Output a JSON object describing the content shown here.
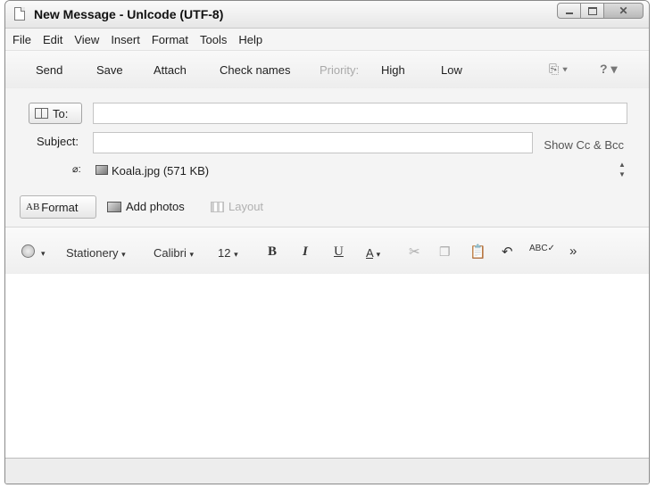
{
  "window": {
    "title": "New Message - Unlcode (UTF-8)"
  },
  "menu": [
    "File",
    "Edit",
    "View",
    "Insert",
    "Format",
    "Tools",
    "Help"
  ],
  "toolbar": {
    "send": "Send",
    "save": "Save",
    "attach": "Attach",
    "check_names": "Check names",
    "priority": "Priority:",
    "high": "High",
    "low": "Low"
  },
  "header": {
    "to_label": "To:",
    "to_value": "",
    "subject_label": "Subject:",
    "subject_value": "",
    "show_cc_bcc": "Show Cc & Bcc",
    "attach_label": ":",
    "attachment": "Koala.jpg (571 KB)"
  },
  "format_bar": {
    "format": "Format",
    "format_icon": "AB",
    "add_photos": "Add photos",
    "layout": "Layout"
  },
  "rich_toolbar": {
    "stationery": "Stationery",
    "font": "Calibri",
    "size": "12",
    "bold": "B",
    "italic": "I",
    "underline": "U",
    "font_color": "A",
    "more": "»"
  },
  "message_body": ""
}
